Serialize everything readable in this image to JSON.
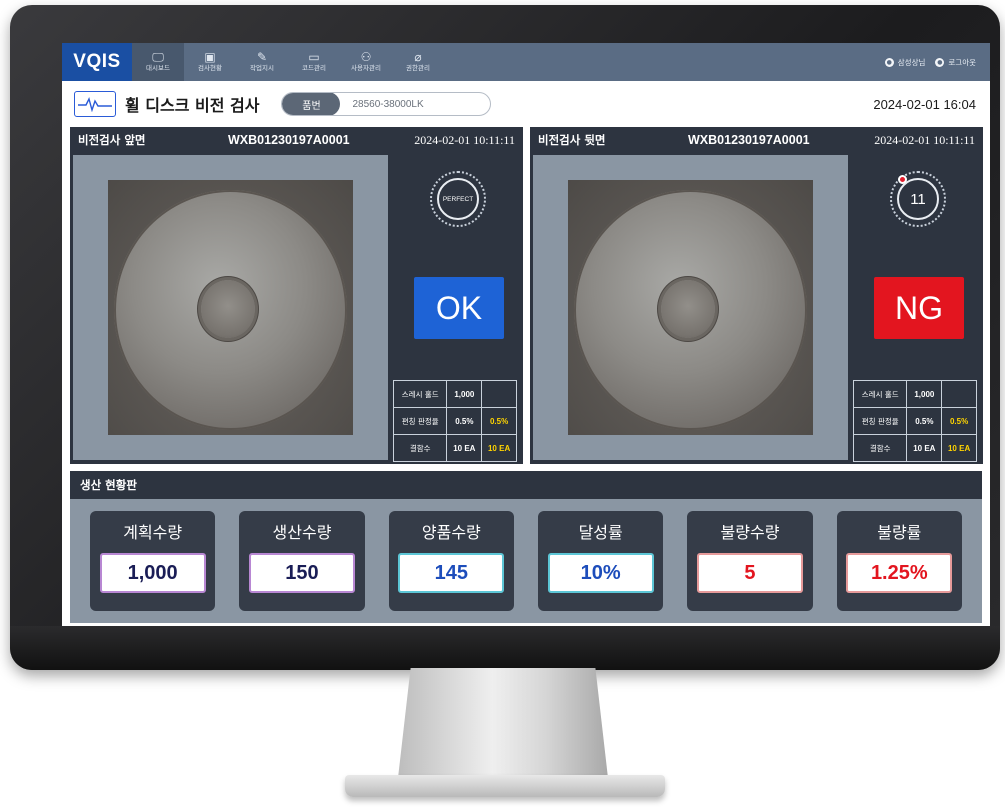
{
  "app": {
    "logo": "VQIS"
  },
  "nav": {
    "items": [
      {
        "label": "대시보드",
        "icon": "monitor-icon"
      },
      {
        "label": "검사현황",
        "icon": "camera-icon"
      },
      {
        "label": "작업지시",
        "icon": "edit-icon"
      },
      {
        "label": "코드관리",
        "icon": "window-icon"
      },
      {
        "label": "사용자관리",
        "icon": "users-icon"
      },
      {
        "label": "권한관리",
        "icon": "lock-icon"
      }
    ],
    "user_name": "삼성상님",
    "logout_label": "로그아웃"
  },
  "header": {
    "title": "휠 디스크 비전 검사",
    "part_label": "품번",
    "part_value": "28560-38000LK",
    "datetime": "2024-02-01  16:04"
  },
  "front": {
    "title": "비전검사 앞면",
    "serial": "WXB01230197A0001",
    "time": "2024-02-01  10:11:11",
    "gauge_text": "PERFECT",
    "result": "OK",
    "stats": {
      "threshold_label": "스레시 홀드",
      "threshold_value": "1,000",
      "rate_label": "편칭 판정율",
      "rate_value": "0.5%",
      "rate_value2": "0.5%",
      "defect_label": "결함수",
      "defect_value": "10 EA",
      "defect_value2": "10 EA"
    }
  },
  "back": {
    "title": "비전검사 뒷면",
    "serial": "WXB01230197A0001",
    "time": "2024-02-01  10:11:11",
    "gauge_text": "11",
    "result": "NG",
    "stats": {
      "threshold_label": "스레시 홀드",
      "threshold_value": "1,000",
      "rate_label": "편칭 판정율",
      "rate_value": "0.5%",
      "rate_value2": "0.5%",
      "defect_label": "결함수",
      "defect_value": "10 EA",
      "defect_value2": "10 EA"
    }
  },
  "board": {
    "title": "생산 현황판",
    "cards": [
      {
        "label": "계획수량",
        "value": "1,000"
      },
      {
        "label": "생산수량",
        "value": "150"
      },
      {
        "label": "양품수량",
        "value": "145"
      },
      {
        "label": "달성률",
        "value": "10%"
      },
      {
        "label": "불량수량",
        "value": "5"
      },
      {
        "label": "불량률",
        "value": "1.25%"
      }
    ]
  },
  "colors": {
    "ok": "#1e63d6",
    "ng": "#e3151f",
    "nav": "#5a6c84",
    "logo": "#1a4fa3"
  }
}
